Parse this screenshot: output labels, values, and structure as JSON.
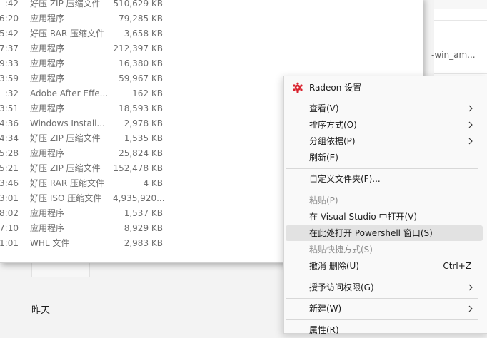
{
  "files": [
    {
      "time": ":42",
      "type": "好压 ZIP 压缩文件",
      "size": "510,629 KB"
    },
    {
      "time": "6:20",
      "type": "应用程序",
      "size": "79,285 KB"
    },
    {
      "time": "5:42",
      "type": "好压 RAR 压缩文件",
      "size": "3,658 KB"
    },
    {
      "time": "7:37",
      "type": "应用程序",
      "size": "212,397 KB"
    },
    {
      "time": "9:33",
      "type": "应用程序",
      "size": "16,380 KB"
    },
    {
      "time": "3:59",
      "type": "应用程序",
      "size": "59,967 KB"
    },
    {
      "time": ":32",
      "type": "Adobe After Effe...",
      "size": "162 KB"
    },
    {
      "time": "3:51",
      "type": "应用程序",
      "size": "18,593 KB"
    },
    {
      "time": "4:36",
      "type": "Windows Install...",
      "size": "2,978 KB"
    },
    {
      "time": "4:34",
      "type": "好压 ZIP 压缩文件",
      "size": "1,535 KB"
    },
    {
      "time": "5:28",
      "type": "应用程序",
      "size": "25,824 KB"
    },
    {
      "time": "5:21",
      "type": "好压 ZIP 压缩文件",
      "size": "152,478 KB"
    },
    {
      "time": "3:46",
      "type": "好压 RAR 压缩文件",
      "size": "4 KB"
    },
    {
      "time": "3:01",
      "type": "好压 ISO 压缩文件",
      "size": "4,935,920..."
    },
    {
      "time": "8:02",
      "type": "应用程序",
      "size": "1,537 KB"
    },
    {
      "time": "7:10",
      "type": "应用程序",
      "size": "8,929 KB"
    },
    {
      "time": "1:01",
      "type": "WHL 文件",
      "size": "2,983 KB"
    }
  ],
  "background": {
    "partial_file_name": "-win_am...",
    "group_yesterday": "昨天"
  },
  "menu": {
    "radeon": "Radeon 设置",
    "view": "查看(V)",
    "sort": "排序方式(O)",
    "group": "分组依据(P)",
    "refresh": "刷新(E)",
    "customize": "自定义文件夹(F)...",
    "paste": "粘贴(P)",
    "open_vs": "在 Visual Studio 中打开(V)",
    "open_ps": "在此处打开 Powershell 窗口(S)",
    "paste_shortcut": "粘贴快捷方式(S)",
    "undo_delete": "撤消 删除(U)",
    "undo_shortcut": "Ctrl+Z",
    "grant_access": "授予访问权限(G)",
    "new": "新建(W)",
    "properties": "属性(R)"
  },
  "colors": {
    "radeon_red": "#d9232e",
    "hover_bg": "#e2e2e2"
  }
}
